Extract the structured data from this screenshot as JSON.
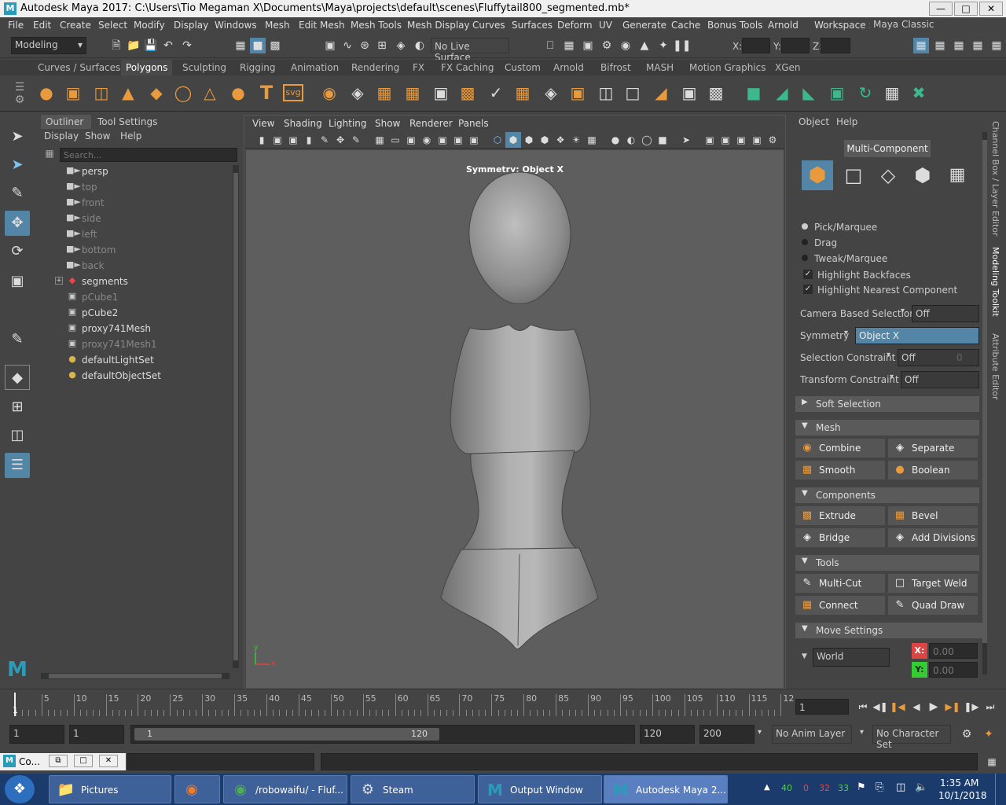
{
  "window": {
    "title": "Autodesk Maya 2017: C:\\Users\\Tio Megaman X\\Documents\\Maya\\projects\\default\\scenes\\Fluffytail800_segmented.mb*",
    "logo": "M",
    "controls": [
      "minimize-icon",
      "maximize-icon",
      "close-icon"
    ]
  },
  "menubar": [
    "File",
    "Edit",
    "Create",
    "Select",
    "Modify",
    "Display",
    "Windows",
    "Mesh",
    "Edit Mesh",
    "Mesh Tools",
    "Mesh Display",
    "Curves",
    "Surfaces",
    "Deform",
    "UV",
    "Generate",
    "Cache",
    "Bonus Tools",
    "Arnold"
  ],
  "workspace": {
    "label": "Workspace :",
    "value": "Maya Classic"
  },
  "statusline": {
    "mode": "Modeling",
    "live_surface": "No Live Surface",
    "x_label": "X:",
    "y_label": "Y:",
    "z_label": "Z:"
  },
  "shelf_tabs": [
    "Curves / Surfaces",
    "Polygons",
    "Sculpting",
    "Rigging",
    "Animation",
    "Rendering",
    "FX",
    "FX Caching",
    "Custom",
    "Arnold",
    "Bifrost",
    "MASH",
    "Motion Graphics",
    "XGen"
  ],
  "shelf_active": "Polygons",
  "shelf_text_icons": {
    "text": "T",
    "svg": "svg"
  },
  "outliner": {
    "tabs": [
      "Outliner",
      "Tool Settings"
    ],
    "menu": [
      "Display",
      "Show",
      "Help"
    ],
    "search_placeholder": "Search...",
    "items": [
      {
        "label": "persp",
        "icon": "camera-icon",
        "dim": false
      },
      {
        "label": "top",
        "icon": "camera-icon",
        "dim": true
      },
      {
        "label": "front",
        "icon": "camera-icon",
        "dim": true
      },
      {
        "label": "side",
        "icon": "camera-icon",
        "dim": true
      },
      {
        "label": "left",
        "icon": "camera-icon",
        "dim": true
      },
      {
        "label": "bottom",
        "icon": "camera-icon",
        "dim": true
      },
      {
        "label": "back",
        "icon": "camera-icon",
        "dim": true
      },
      {
        "label": "segments",
        "icon": "group-icon",
        "dim": false
      },
      {
        "label": "pCube1",
        "icon": "mesh-icon",
        "dim": true
      },
      {
        "label": "pCube2",
        "icon": "mesh-icon",
        "dim": false
      },
      {
        "label": "proxy741Mesh",
        "icon": "mesh-icon",
        "dim": false
      },
      {
        "label": "proxy741Mesh1",
        "icon": "mesh-icon",
        "dim": true
      },
      {
        "label": "defaultLightSet",
        "icon": "set-icon",
        "dim": false
      },
      {
        "label": "defaultObjectSet",
        "icon": "set-icon",
        "dim": false
      }
    ]
  },
  "viewport": {
    "menu": [
      "View",
      "Shading",
      "Lighting",
      "Show",
      "Renderer",
      "Panels"
    ],
    "hud": "Symmetry: Object X",
    "axis_y": "y",
    "axis_x": "x"
  },
  "toolkit": {
    "menu": [
      "Object",
      "Help"
    ],
    "mode_title": "Multi-Component",
    "selection_modes": [
      "Pick/Marquee",
      "Drag",
      "Tweak/Marquee"
    ],
    "checks": [
      "Highlight Backfaces",
      "Highlight Nearest Component"
    ],
    "camera_based": {
      "label": "Camera Based Selection",
      "value": "Off"
    },
    "symmetry": {
      "label": "Symmetry",
      "value": "Object X"
    },
    "selection_constraint": {
      "label": "Selection Constraint",
      "value": "Off",
      "extra": "0"
    },
    "transform_constraint": {
      "label": "Transform Constraint",
      "value": "Off"
    },
    "soft_selection": "Soft Selection",
    "mesh": {
      "title": "Mesh",
      "buttons": [
        "Combine",
        "Separate",
        "Smooth",
        "Boolean"
      ]
    },
    "components": {
      "title": "Components",
      "buttons": [
        "Extrude",
        "Bevel",
        "Bridge",
        "Add Divisions"
      ]
    },
    "tools": {
      "title": "Tools",
      "buttons": [
        "Multi-Cut",
        "Target Weld",
        "Connect",
        "Quad Draw"
      ]
    },
    "move_settings": {
      "title": "Move Settings",
      "space": "World",
      "x_label": "X:",
      "x_value": "0.00",
      "y_label": "Y:",
      "y_value": "0.00"
    }
  },
  "side_tabs": [
    "Channel Box / Layer Editor",
    "Modeling Toolkit",
    "Attribute Editor"
  ],
  "timeline": {
    "ticks": [
      "5",
      "10",
      "15",
      "20",
      "25",
      "30",
      "35",
      "40",
      "45",
      "50",
      "55",
      "60",
      "65",
      "70",
      "75",
      "80",
      "85",
      "90",
      "95",
      "100",
      "105",
      "110",
      "115",
      "12"
    ],
    "current": "1",
    "frame_field": "1"
  },
  "range": {
    "start": "1",
    "start2": "1",
    "slider_start": "1",
    "slider_end": "120",
    "end": "120",
    "end2": "200",
    "anim_layer": "No Anim Layer",
    "char_set": "No Character Set"
  },
  "cmdline": {
    "label": "Co..."
  },
  "taskbar": {
    "items": [
      {
        "label": "Pictures",
        "icon": "folder-icon"
      },
      {
        "label": "",
        "icon": "firefox-icon"
      },
      {
        "label": "/robowaifu/ - Fluf...",
        "icon": "chrome-icon"
      },
      {
        "label": "Steam",
        "icon": "steam-icon"
      },
      {
        "label": "Output Window",
        "icon": "maya-icon"
      },
      {
        "label": "Autodesk Maya 2...",
        "icon": "maya-icon"
      }
    ],
    "tray_numbers": [
      "40",
      "0",
      "32",
      "33"
    ],
    "time": "1:35 AM",
    "date": "10/1/2018"
  },
  "colors": {
    "accent": "#5285a6",
    "symmetry_field": "#5285a6",
    "x_red": "#d44",
    "y_green": "#3c3",
    "taskbar": "#1b3b6c"
  }
}
